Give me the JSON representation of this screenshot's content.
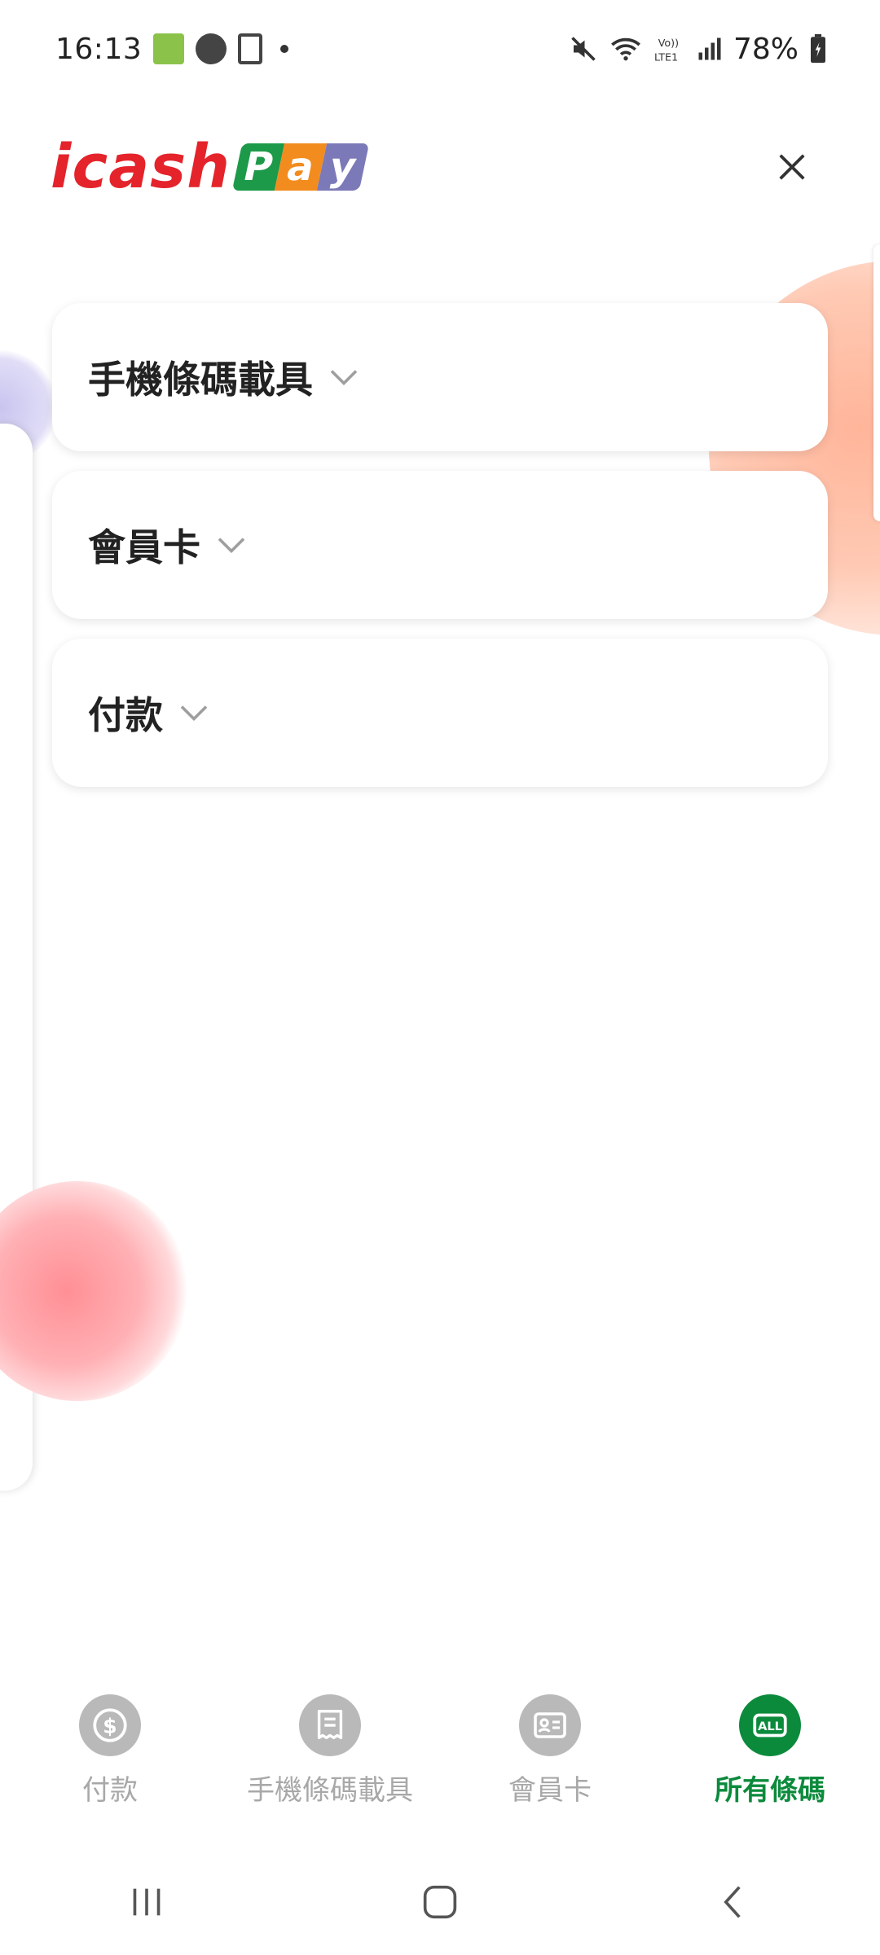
{
  "status_bar": {
    "time": "16:13",
    "battery": "78%",
    "icons": [
      "brooke-app-icon",
      "starbucks-icon",
      "phone-icon",
      "dot-icon",
      "mute-icon",
      "wifi-icon",
      "volte-icon",
      "signal-icon",
      "battery-icon"
    ]
  },
  "header": {
    "logo_text": "icash",
    "logo_pay": [
      "P",
      "a",
      "y"
    ]
  },
  "accordion": [
    {
      "label": "手機條碼載具"
    },
    {
      "label": "會員卡"
    },
    {
      "label": "付款"
    }
  ],
  "bottom_nav": [
    {
      "label": "付款",
      "icon": "dollar-icon",
      "active": false
    },
    {
      "label": "手機條碼載具",
      "icon": "receipt-icon",
      "active": false
    },
    {
      "label": "會員卡",
      "icon": "member-card-icon",
      "active": false
    },
    {
      "label": "所有條碼",
      "icon": "all-icon",
      "active": true,
      "icon_text": "ALL"
    }
  ],
  "colors": {
    "brand_red": "#e4232b",
    "active_green": "#0c8a3c",
    "inactive_gray": "#a8a8a8"
  }
}
